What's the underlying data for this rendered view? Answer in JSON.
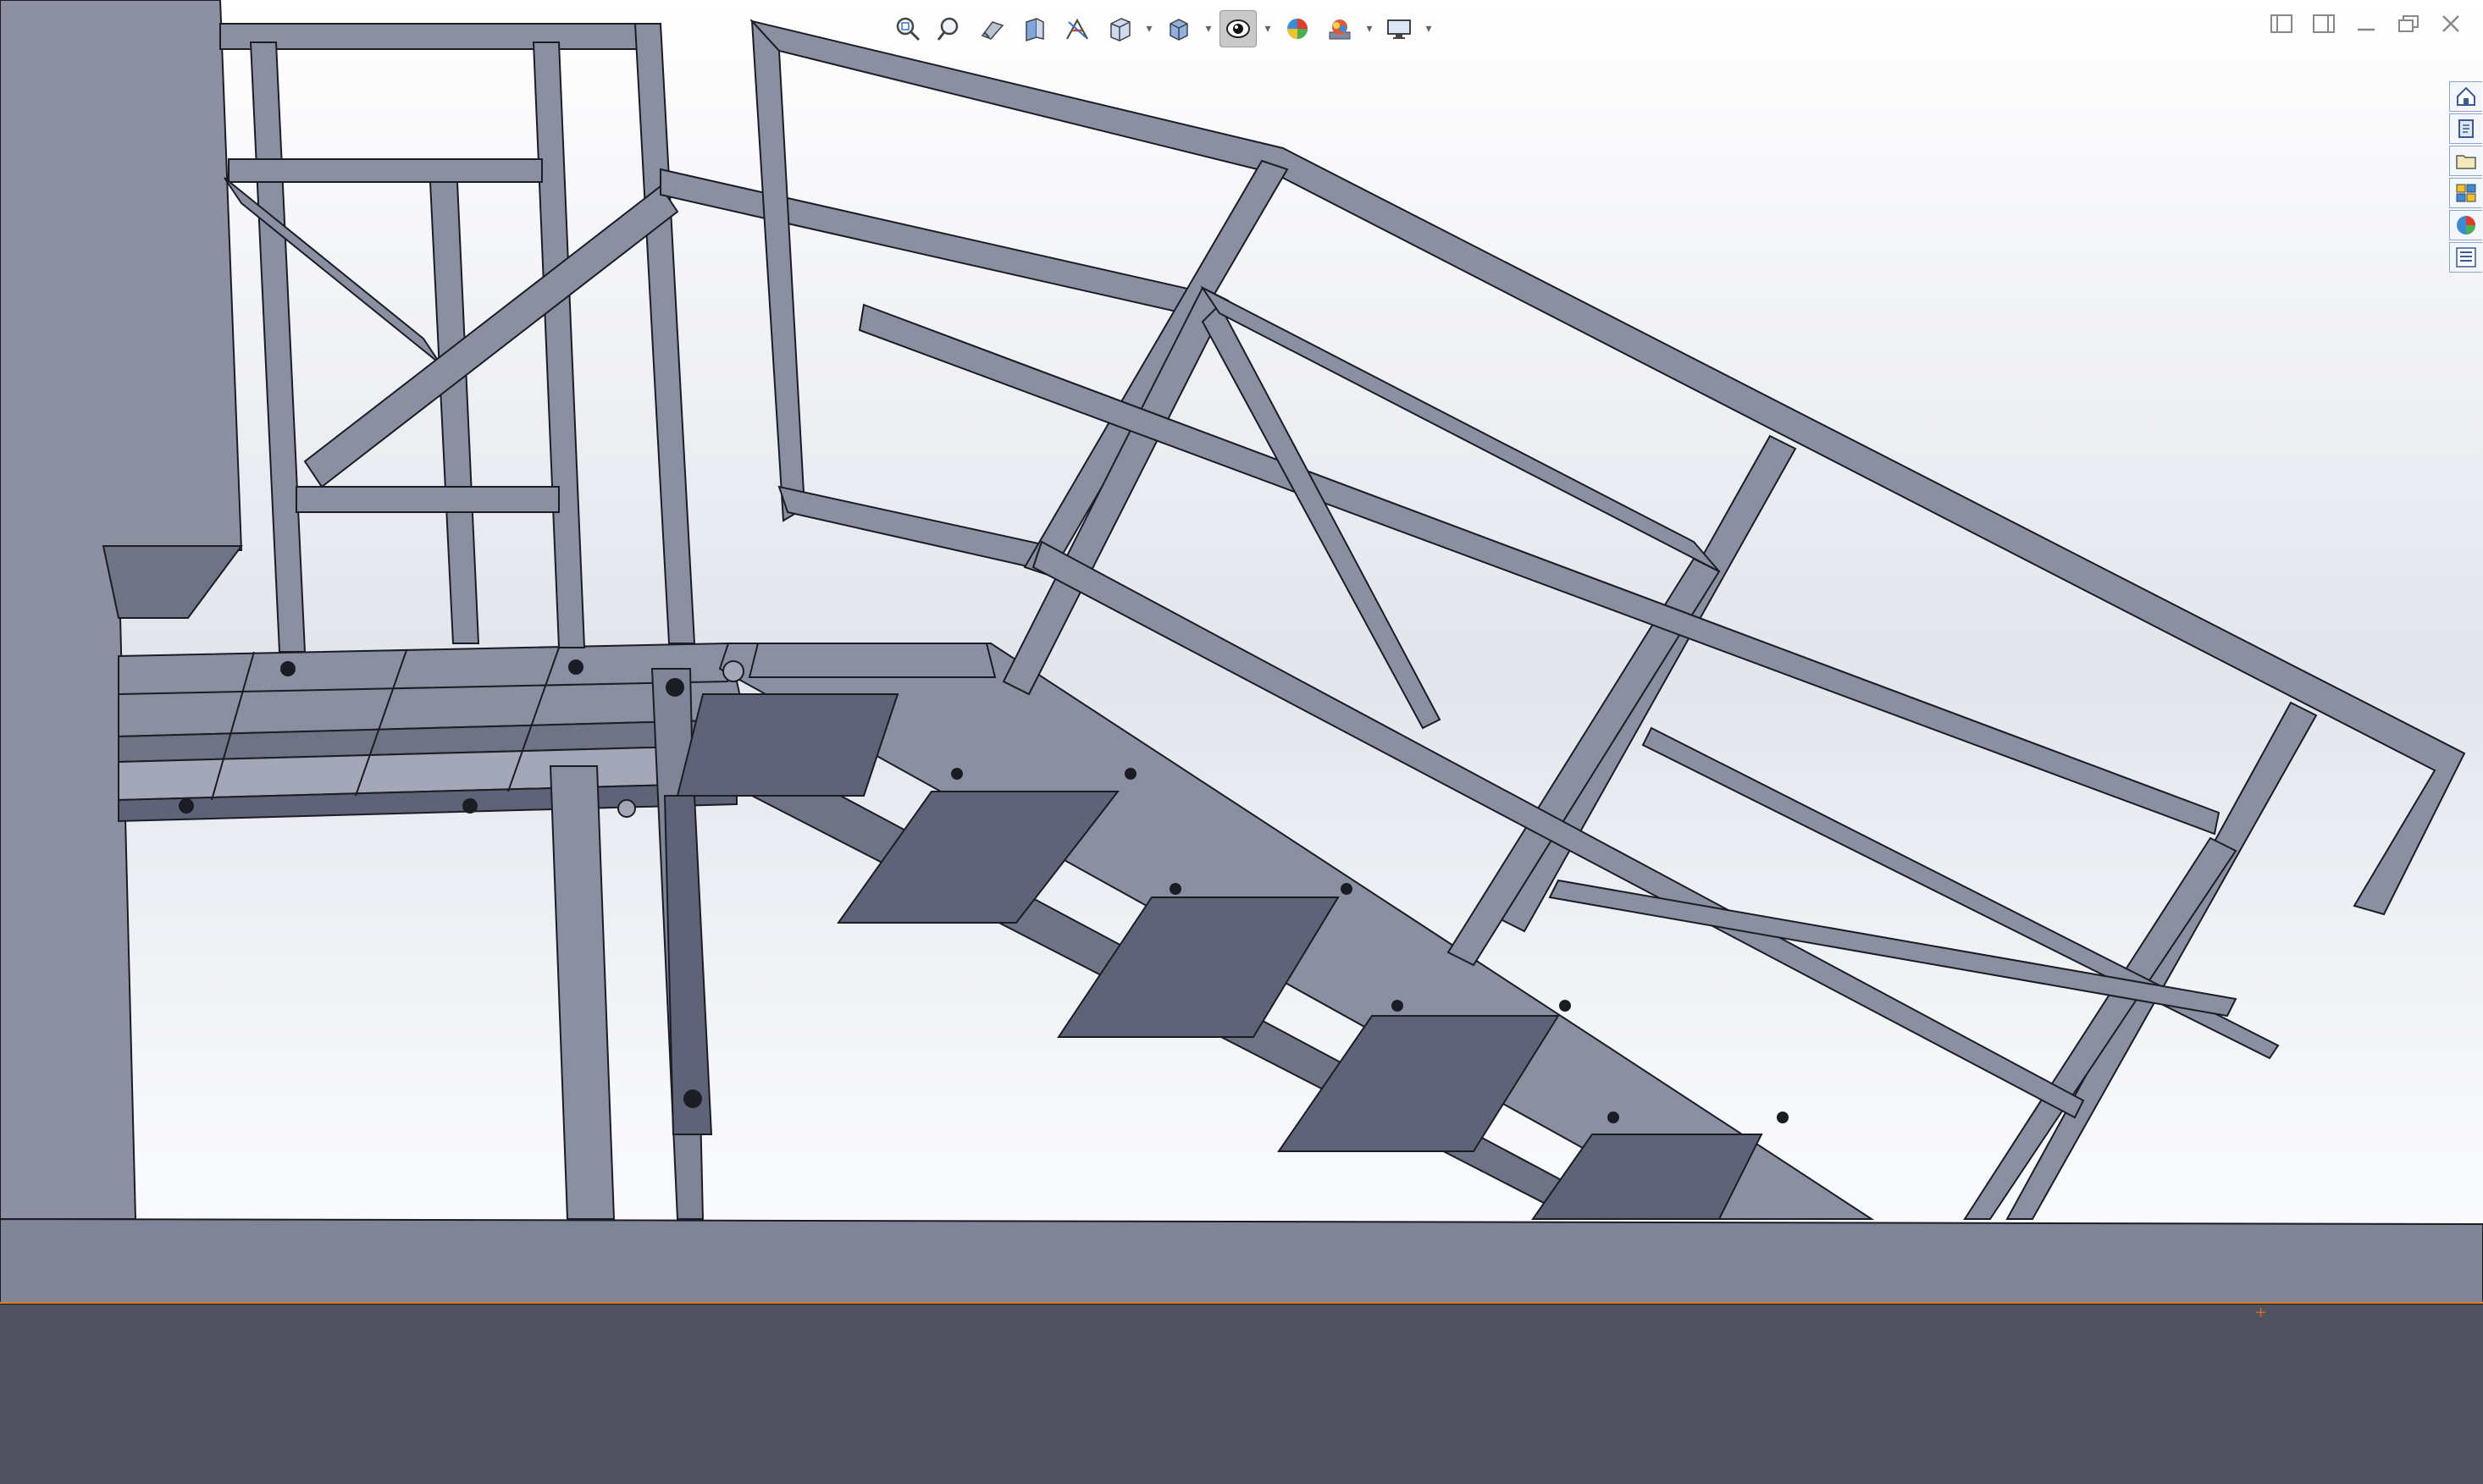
{
  "app": {
    "viewport_kind": "3D model graphics area"
  },
  "heads_up_toolbar": {
    "buttons": [
      {
        "id": "zoom-to-fit",
        "icon": "magnifier-fit-icon"
      },
      {
        "id": "zoom-to-area",
        "icon": "magnifier-area-icon"
      },
      {
        "id": "previous-view",
        "icon": "previous-view-icon"
      },
      {
        "id": "section-view",
        "icon": "section-view-icon"
      },
      {
        "id": "dynamic-annotation",
        "icon": "annotation-views-icon"
      },
      {
        "id": "view-orientation",
        "icon": "view-orientation-cube-icon",
        "has_dropdown": true
      },
      {
        "id": "display-style",
        "icon": "display-style-cube-icon",
        "has_dropdown": true
      },
      {
        "id": "hide-show-items",
        "icon": "eye-icon",
        "has_dropdown": true,
        "active": true
      },
      {
        "id": "edit-appearance",
        "icon": "appearance-ball-icon"
      },
      {
        "id": "apply-scene",
        "icon": "scene-icon",
        "has_dropdown": true
      },
      {
        "id": "view-settings",
        "icon": "monitor-icon",
        "has_dropdown": true
      }
    ]
  },
  "window_controls": [
    "tile-left-icon",
    "tile-right-icon",
    "minimize-icon",
    "restore-icon",
    "close-icon"
  ],
  "task_pane_tabs": [
    "home-icon",
    "design-library-icon",
    "file-explorer-icon",
    "view-palette-icon",
    "appearances-icon",
    "custom-properties-icon"
  ],
  "colors": {
    "steel": "#8b8fa2",
    "steel_dark": "#5f6377",
    "steel_light": "#a3a7b8",
    "edge": "#1c1d24",
    "wall": "#8d90a2",
    "floor": "#7f8497",
    "ground": "#50525f",
    "background_top": "#ffffff",
    "background_mid": "#e3e5ec",
    "reference_line": "#e47b25",
    "taskpane_border": "#8fa4c9"
  }
}
